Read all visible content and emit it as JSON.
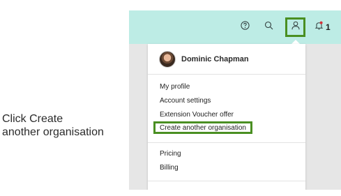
{
  "caption": {
    "line1": "Click Create",
    "line2": "another organisation"
  },
  "topbar": {
    "help_icon": "help-circle-icon",
    "search_icon": "search-icon",
    "user_icon": "user-icon",
    "notification_icon": "bell-icon",
    "notification_count": "1",
    "background": "#bdece5",
    "highlight_color": "#4a8f22"
  },
  "dropdown": {
    "user_name": "Dominic Chapman",
    "section1": [
      "My profile",
      "Account settings",
      "Extension Voucher offer",
      "Create another organisation"
    ],
    "section2": [
      "Pricing",
      "Billing"
    ]
  }
}
